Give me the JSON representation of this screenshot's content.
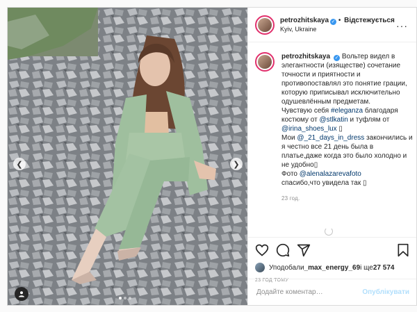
{
  "profile": {
    "username": "petrozhitskaya",
    "follow_label": "Відстежується",
    "location": "Kyiv, Ukraine",
    "more_label": "···"
  },
  "caption": {
    "username": "petrozhitskaya",
    "line1": "Вольтер видел в элегантности (изяществе) сочетание точности и приятности и противопоставлял это понятие грации, которую приписывал исключительно одушевлённым предметам.",
    "l2a": "Чувствую себя ",
    "tag_eleganza": "#eleganza",
    "l2b": " благодаря костюму от ",
    "tag_stlkatin": "@stlkatin",
    "l2c": " и туфлям от ",
    "tag_irina": "@irina_shoes_lux",
    "l2d": " ▯",
    "l3a": "Мои ",
    "tag_days": "@_21_days_in_dress",
    "l3b": " закончились и я честно все 21 день была в платье,даже когда это было холодно и не удобно▯",
    "l4a": "Фото ",
    "tag_foto": "@alenalazarevafoto",
    "l5": "спасибо,что увидела так ▯",
    "time": "23 год."
  },
  "likes": {
    "prefix": "Уподобали ",
    "user": "_max_energy_69",
    "middle": " і ще ",
    "count": "27 574"
  },
  "posted_ago": "23 ГОД ТОМУ",
  "comment": {
    "placeholder": "Додайте коментар…",
    "publish_label": "Опублікувати"
  },
  "colors": {
    "accent": "#3897f0",
    "link": "#00376b",
    "suit": "#9fbf9e",
    "rocks": "#8a8e93"
  },
  "carousel": {
    "slides": 3,
    "active": 0
  }
}
